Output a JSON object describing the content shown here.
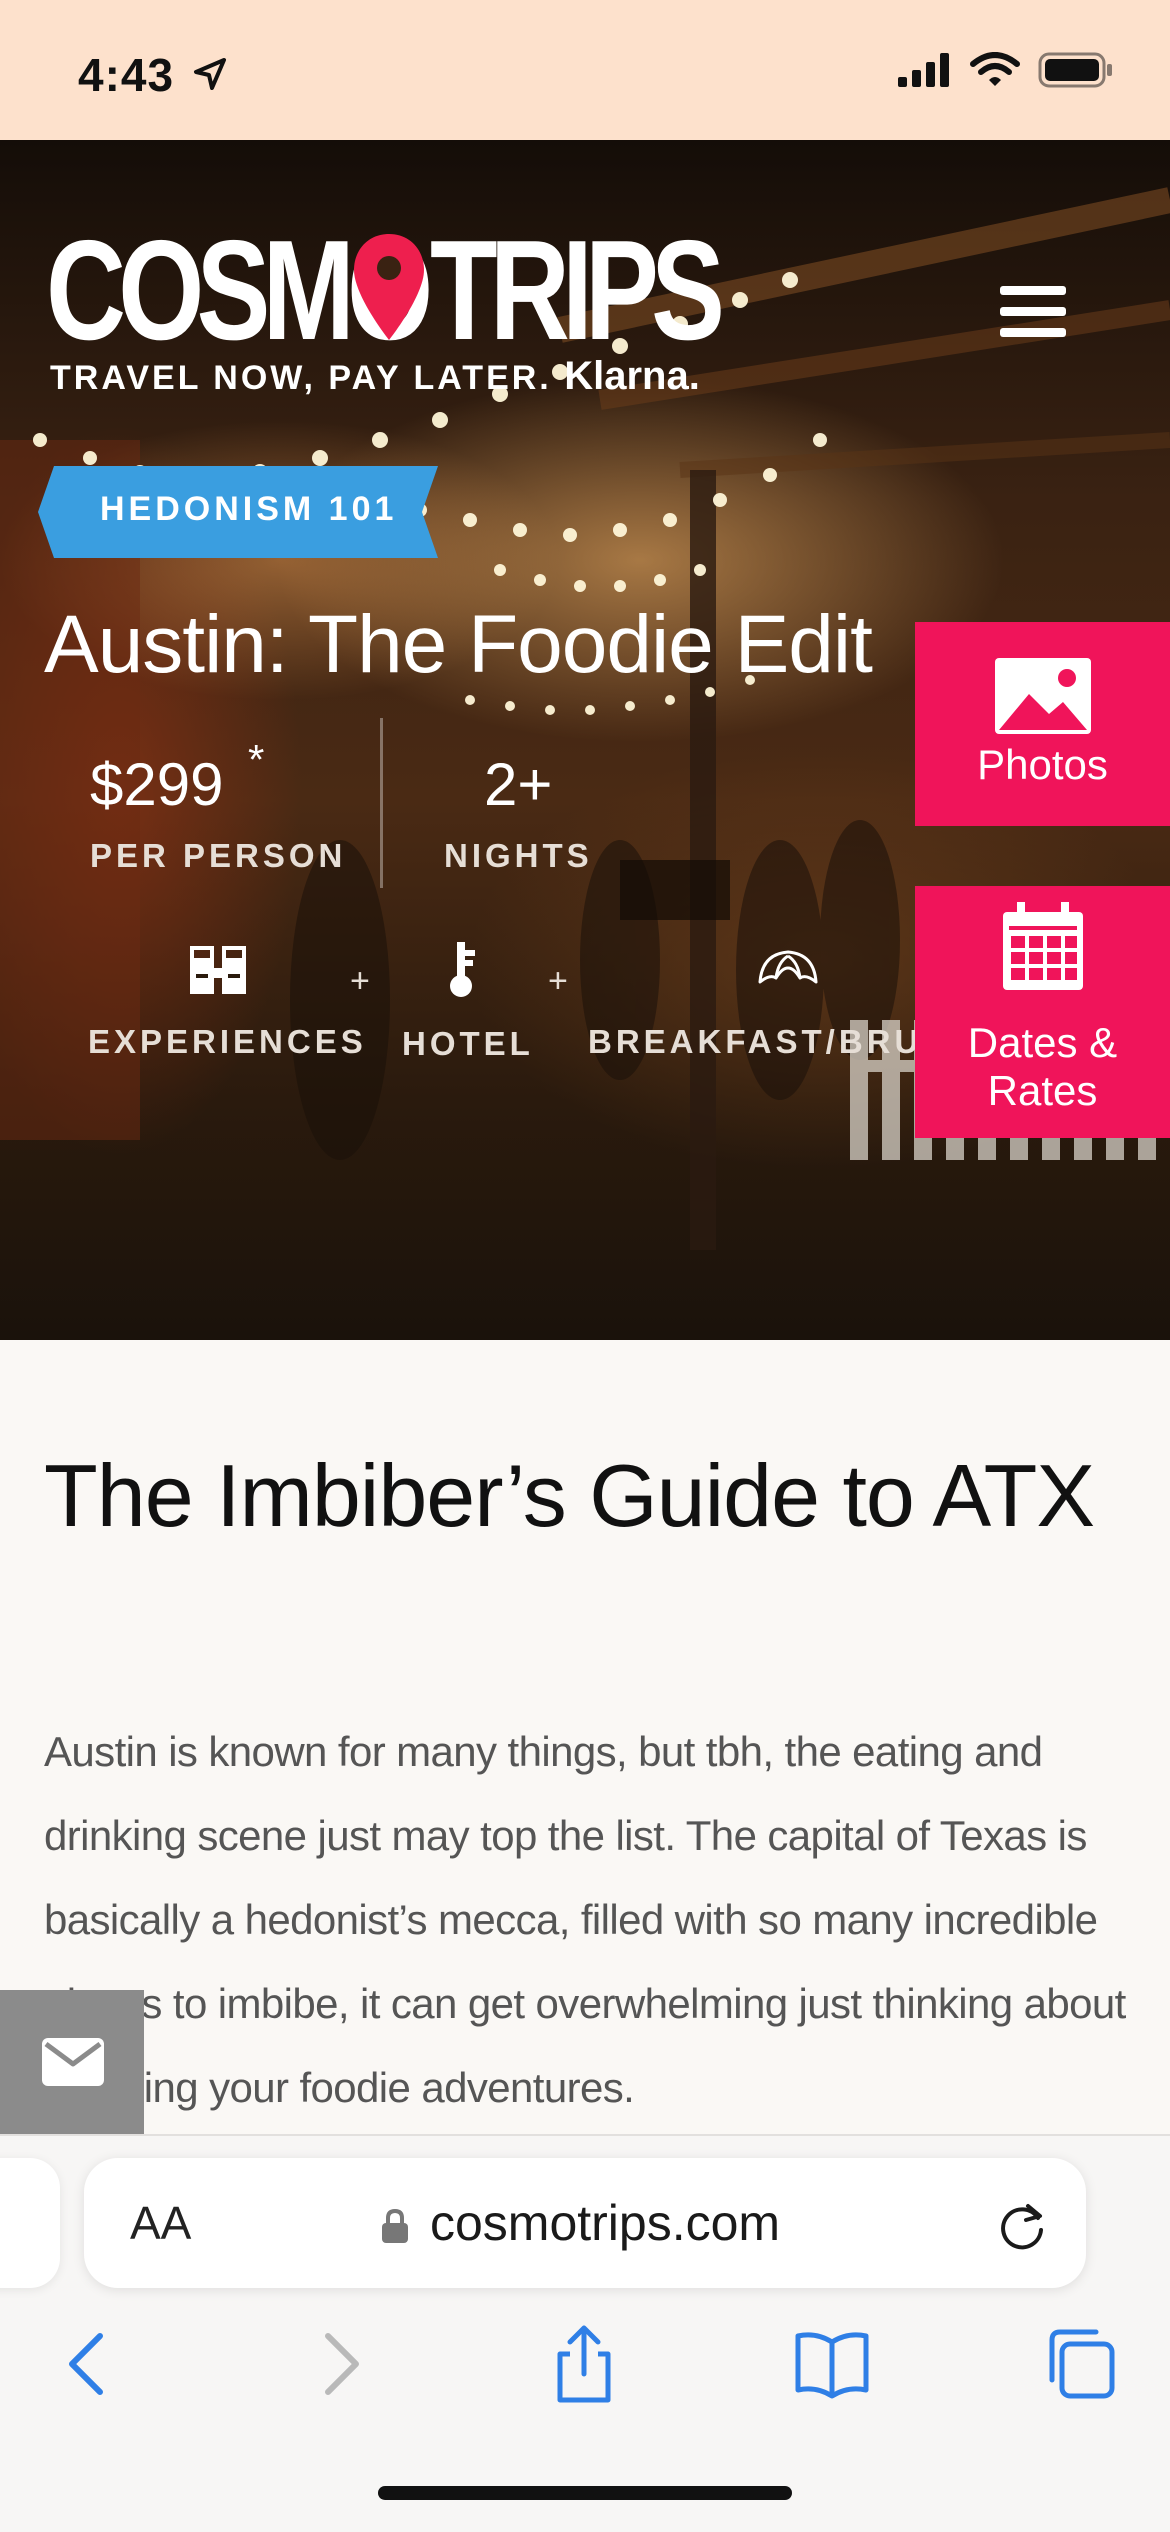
{
  "status_bar": {
    "time": "4:43"
  },
  "brand": {
    "logo_left": "COSMO",
    "logo_right": "TRIPS",
    "tagline": "TRAVEL NOW, PAY LATER.",
    "tagline_brand": "Klarna."
  },
  "hero": {
    "category": "HEDONISM 101",
    "title": "Austin: The Foodie Edit",
    "price": "$299",
    "price_note": "*",
    "price_label": "PER PERSON",
    "nights": "2+",
    "nights_label": "NIGHTS",
    "inclusions": [
      {
        "label": "EXPERIENCES",
        "icon": "binoculars-icon"
      },
      {
        "label": "HOTEL",
        "icon": "key-icon"
      },
      {
        "label": "BREAKFAST/BRUNCH",
        "icon": "croissant-icon"
      }
    ],
    "plus": "+"
  },
  "side_buttons": {
    "photos": "Photos",
    "dates_line1": "Dates &",
    "dates_line2": "Rates"
  },
  "article": {
    "heading": "The Imbiber’s Guide to ATX",
    "body": "Austin is known for many things, but tbh, the eating and drinking scene just may top the list. The capital of Texas is basically a hedonist’s mecca, filled with so many incredible places to imbibe, it can get overwhelming just thinking about planning your foodie adventures."
  },
  "browser": {
    "text_size_label": "AA",
    "url": "cosmotrips.com"
  },
  "colors": {
    "status_bg": "#fde1cc",
    "accent_pink": "#f0145a",
    "badge_blue": "#3a9ee0",
    "ios_blue": "#2f7fe6"
  }
}
